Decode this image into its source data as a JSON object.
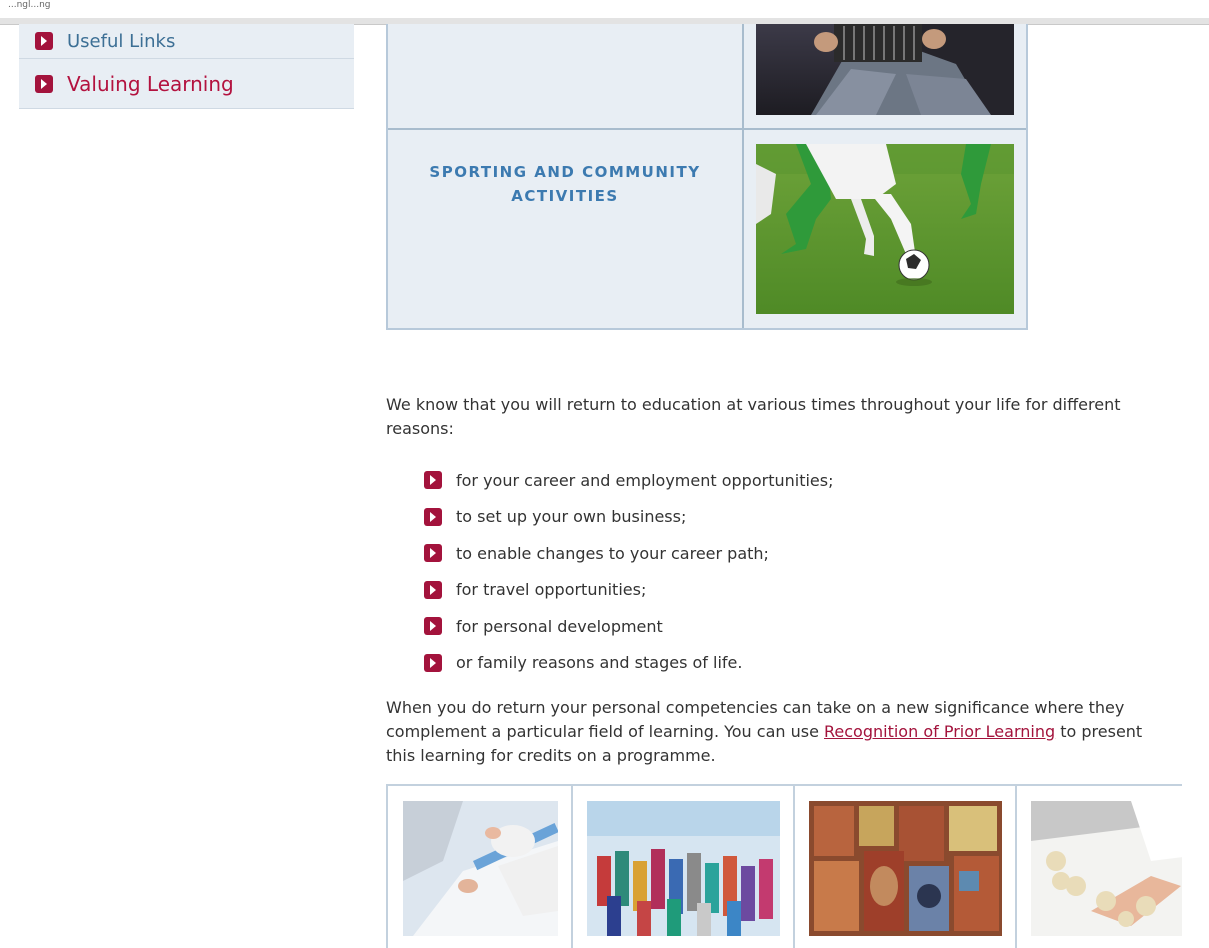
{
  "top_fragment": "...ngl...ng",
  "sidebar": {
    "items": [
      {
        "label": "Useful Links"
      },
      {
        "label": "Valuing Learning"
      }
    ]
  },
  "grid": {
    "sporting_title": "SPORTING AND COMMUNITY ACTIVITIES"
  },
  "content": {
    "intro": "We know that you will return to education at various times throughout your life for different reasons:",
    "reasons": [
      "for your career and employment opportunities;",
      "to set up your own business;",
      "to enable changes to your career path;",
      "for travel opportunities;",
      "for personal development",
      "or family reasons and stages of life."
    ],
    "para2_before": "When you do return your personal competencies can take on a new significance where they complement a particular field of learning. You can use ",
    "para2_link": "Recognition of Prior Learning",
    "para2_after": " to present this learning for credits on a programme."
  },
  "colors": {
    "accent": "#a3133c",
    "link_blue": "#3c6f95",
    "panel": "#e8eef4",
    "heading_blue": "#3c7ab0"
  }
}
